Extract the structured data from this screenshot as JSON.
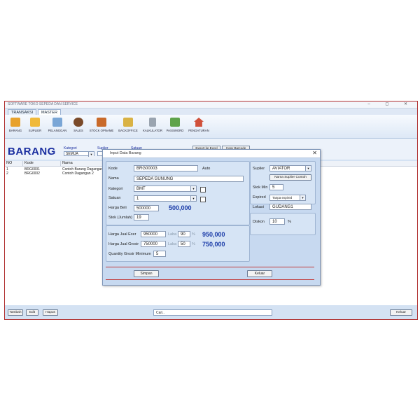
{
  "window": {
    "title": "SOFTWARE TOKO SEPEDA DAN SERVICE",
    "controls": "–  ◻  ✕"
  },
  "tabs": [
    {
      "label": "TRANSAKSI"
    },
    {
      "label": "MASTER"
    }
  ],
  "ribbon": [
    {
      "label": "BARANG",
      "icon": "box-icon",
      "color": "#e8a22c"
    },
    {
      "label": "SUPLIER",
      "icon": "supplier-icon",
      "color": "#f0b93a"
    },
    {
      "label": "PELANGGAN",
      "icon": "customer-icon",
      "color": "#7aa6d6"
    },
    {
      "label": "SALES",
      "icon": "sales-person-icon",
      "color": "#7a4a2a"
    },
    {
      "label": "STOCK OPNAME",
      "icon": "stock-opname-icon",
      "color": "#c96a2a"
    },
    {
      "label": "BACKOFFICE",
      "icon": "backoffice-icon",
      "color": "#d9b244"
    },
    {
      "label": "KALKULATOR",
      "icon": "calculator-icon",
      "color": "#9aa4b0"
    },
    {
      "label": "PASSWORD",
      "icon": "password-icon",
      "color": "#5fa34a"
    },
    {
      "label": "PENGATURAN",
      "icon": "settings-house-icon",
      "color": "#d0503a"
    }
  ],
  "header": {
    "title": "BARANG",
    "kategori_label": "Kategori",
    "kategori_value": "SEMUA",
    "suplier_label": "Suplier",
    "satuan_label": "Satuan",
    "export_label": "Export ke Excel",
    "copy_label": "Copy Barcode"
  },
  "grid": {
    "columns": [
      "NO",
      "Kode",
      "Nama"
    ],
    "rows": [
      {
        "no": "1",
        "kode": "BRG0001",
        "nama": "Contoh Barang Dagangan"
      },
      {
        "no": "2",
        "kode": "BRG0002",
        "nama": "Contoh Dagangan 2"
      }
    ]
  },
  "bottom": {
    "tambah": "Tambah",
    "edit": "Edit",
    "hapus": "Hapus",
    "search_value": "Cari..",
    "keluar": "Keluar"
  },
  "dialog": {
    "title": "Input Data Barang",
    "kode_label": "Kode",
    "kode_value": "BRG00003",
    "auto_label": "Auto",
    "nama_label": "Nama",
    "nama_value": "SEPEDA GUNUNG",
    "kategori_label": "Kategori",
    "kategori_value": "BMT",
    "satuan_label": "Satuan",
    "satuan_value": "1",
    "harga_beli_label": "Harga Beli",
    "harga_beli_value": "500000",
    "harga_beli_display": "500,000",
    "stok_label": "Stok (Jumlah)",
    "stok_value": "19",
    "harga_ecer_label": "Harga Jual Ecer",
    "harga_ecer_value": "950000",
    "laba_label": "Laba",
    "laba_ecer_value": "90",
    "percent": "%",
    "harga_ecer_display": "950,000",
    "harga_grosir_label": "Harga Jual Grosir",
    "harga_grosir_value": "750000",
    "laba_grosir_value": "50",
    "harga_grosir_display": "750,000",
    "qty_grosir_label": "Quantity Grosir Minimum",
    "qty_grosir_value": "5",
    "suplier_label": "Suplier",
    "suplier_value": "AVIATOR",
    "nama_suplier_button": "Nama Suplier Contoh",
    "stok_min_label": "Stok Min",
    "stok_min_value": "5",
    "expired_label": "Expired",
    "expired_value": "Tanpa expired",
    "lokasi_label": "Lokasi",
    "lokasi_value": "GUDANG1",
    "diskon_label": "Diskon",
    "diskon_value": "10",
    "simpan_label": "Simpan",
    "keluar_label": "Keluar"
  }
}
